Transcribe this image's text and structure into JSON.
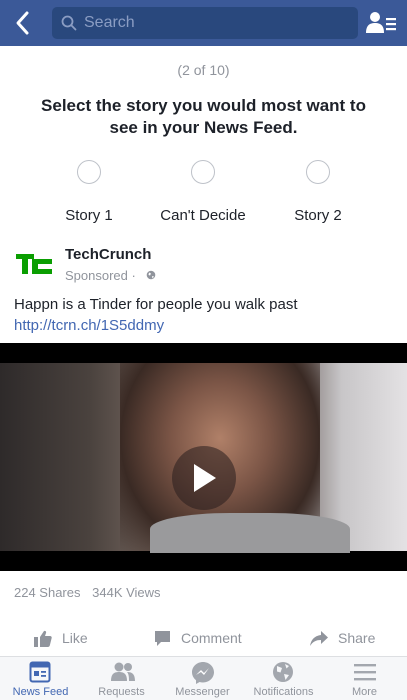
{
  "header": {
    "search_placeholder": "Search"
  },
  "survey": {
    "counter": "(2 of 10)",
    "question": "Select the story you would most want to see in your News Feed.",
    "options": [
      "Story 1",
      "Can't Decide",
      "Story 2"
    ]
  },
  "post": {
    "page_name": "TechCrunch",
    "sponsored_label": "Sponsored",
    "text": "Happn is a Tinder for people you walk past ",
    "link_text": "http://tcrn.ch/1S5ddmy",
    "logo_text": "TC",
    "stats": {
      "shares": "224 Shares",
      "views": "344K Views"
    },
    "actions": {
      "like": "Like",
      "comment": "Comment",
      "share": "Share"
    }
  },
  "tabs": [
    {
      "label": "News Feed",
      "icon": "news-feed-icon",
      "active": true
    },
    {
      "label": "Requests",
      "icon": "friend-requests-icon",
      "active": false
    },
    {
      "label": "Messenger",
      "icon": "messenger-icon",
      "active": false
    },
    {
      "label": "Notifications",
      "icon": "globe-icon",
      "active": false
    },
    {
      "label": "More",
      "icon": "menu-icon",
      "active": false
    }
  ],
  "colors": {
    "brand": "#3b5998",
    "link": "#4267b2",
    "muted": "#90949c",
    "techcrunch_green": "#0a9e01"
  }
}
